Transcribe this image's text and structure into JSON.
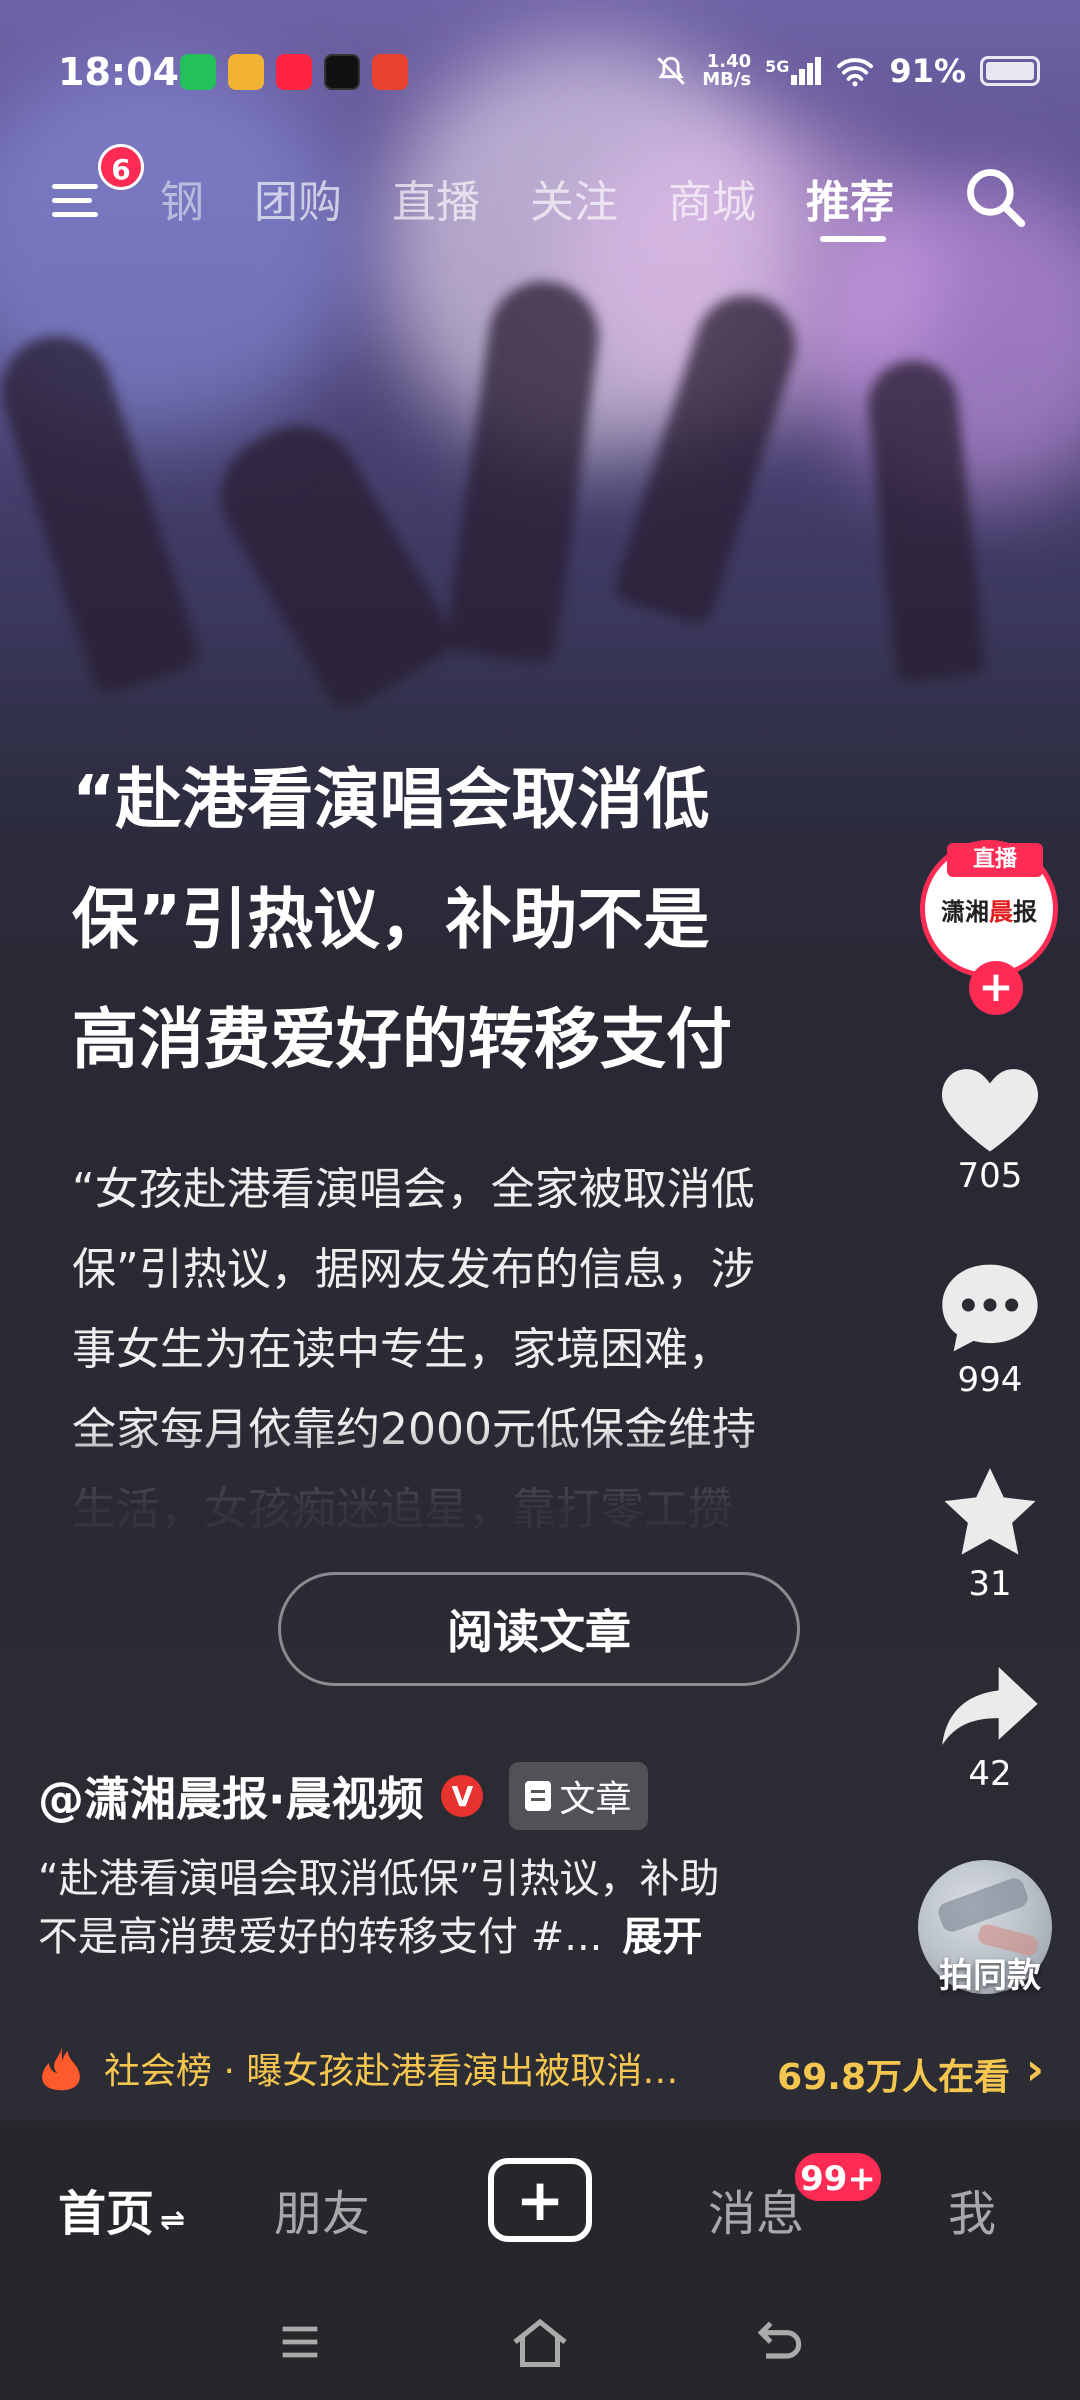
{
  "status_bar": {
    "time": "18:04",
    "net_speed_value": "1.40",
    "net_speed_unit": "MB/s",
    "network": "5G",
    "battery": "91%"
  },
  "top_nav": {
    "menu_badge": "6",
    "tabs": [
      "钢",
      "团购",
      "直播",
      "关注",
      "商城",
      "推荐"
    ],
    "active_tab": "推荐"
  },
  "post": {
    "headline_lines": [
      "“赴港看演唱会取消低",
      "保”引热议，补助不是",
      "高消费爱好的转移支付"
    ],
    "body_lines": [
      "“女孩赴港看演唱会，全家被取消低",
      "保”引热议，据网友发布的信息，涉",
      "事女生为在读中专生，家境困难，",
      "全家每月依靠约2000元低保金维持",
      "生活，女孩痴迷追星，靠打零工攒"
    ],
    "read_button": "阅读文章",
    "author": "@潇湘晨报·晨视频",
    "verified_mark": "V",
    "type_tag": "文章",
    "caption_line1": "“赴港看演唱会取消低保”引热议，补助",
    "caption_line2": "不是高消费爱好的转移支付 #...",
    "expand": "展开"
  },
  "actions": {
    "live_tag": "直播",
    "avatar_text_a": "潇湘",
    "avatar_text_b": "晨",
    "avatar_text_c": "报",
    "follow": "+",
    "likes": "705",
    "comments": "994",
    "favorites": "31",
    "shares": "42",
    "same_style": "拍同款"
  },
  "hot_bar": {
    "topic": "社会榜 · 曝女孩赴港看演出被取消…",
    "viewers": "69.8万人在看",
    "chevron": "›"
  },
  "bottom_nav": {
    "home": "首页",
    "home_suffix": "⇌",
    "friends": "朋友",
    "create": "+",
    "messages": "消息",
    "messages_badge": "99+",
    "me": "我"
  },
  "colors": {
    "accent": "#fe2c55",
    "hot_text": "#f5c64f",
    "bottom_bg": "#26262b"
  }
}
